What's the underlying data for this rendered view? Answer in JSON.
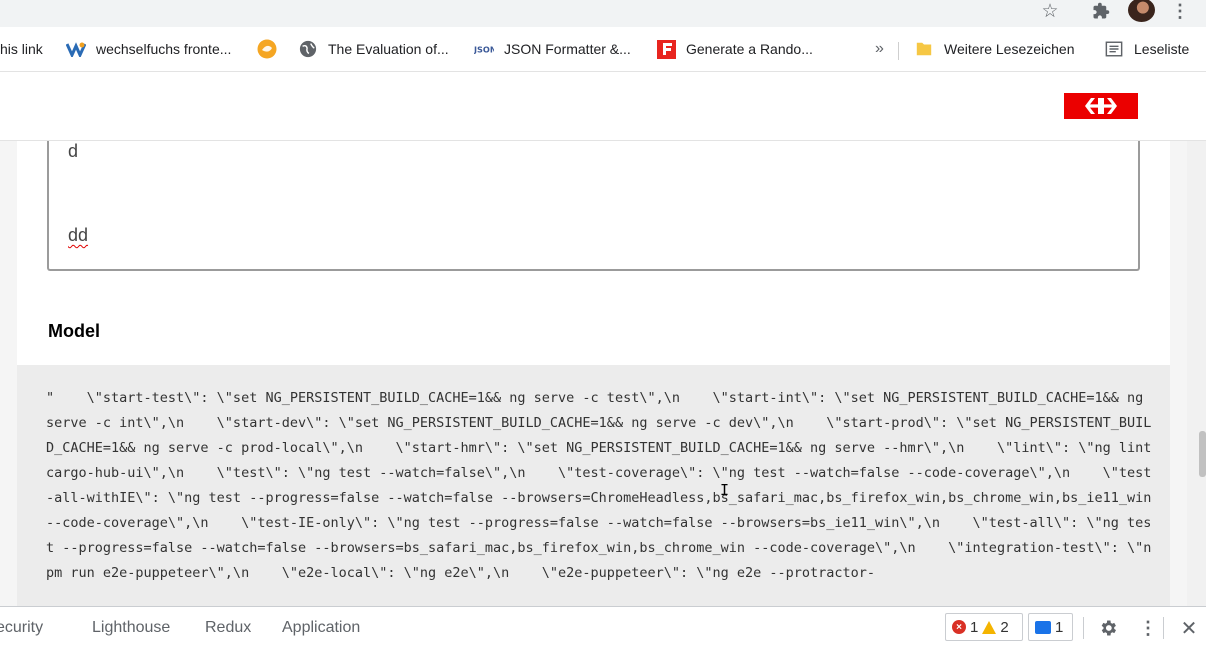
{
  "toolbar": {
    "star_icon": "star-icon",
    "extensions_icon": "puzzle-icon",
    "menu_icon": "kebab-menu-icon"
  },
  "bookmarks": {
    "items": [
      {
        "label": "his link",
        "icon": "none"
      },
      {
        "label": "wechselfuchs fronte...",
        "icon": "wechselfuchs-icon"
      },
      {
        "label": "",
        "icon": "fox-icon"
      },
      {
        "label": "The Evaluation of...",
        "icon": "globe-icon"
      },
      {
        "label": "JSON Formatter &...",
        "icon": "json-icon"
      },
      {
        "label": "Generate a Rando...",
        "icon": "f-icon"
      }
    ],
    "overflow": "»",
    "other_bookmarks": "Weitere Lesezeichen",
    "reading_list": "Leseliste"
  },
  "header": {
    "logo": "sbb-logo"
  },
  "textarea": {
    "line1": "d",
    "line2": "dd"
  },
  "model": {
    "heading": "Model",
    "code": "\"    \\\"start-test\\\": \\\"set NG_PERSISTENT_BUILD_CACHE=1&& ng serve -c test\\\",\\n    \\\"start-int\\\": \\\"set NG_PERSISTENT_BUILD_CACHE=1&& ng serve -c int\\\",\\n    \\\"start-dev\\\": \\\"set NG_PERSISTENT_BUILD_CACHE=1&& ng serve -c dev\\\",\\n    \\\"start-prod\\\": \\\"set NG_PERSISTENT_BUILD_CACHE=1&& ng serve -c prod-local\\\",\\n    \\\"start-hmr\\\": \\\"set NG_PERSISTENT_BUILD_CACHE=1&& ng serve --hmr\\\",\\n    \\\"lint\\\": \\\"ng lint cargo-hub-ui\\\",\\n    \\\"test\\\": \\\"ng test --watch=false\\\",\\n    \\\"test-coverage\\\": \\\"ng test --watch=false --code-coverage\\\",\\n    \\\"test-all-withIE\\\": \\\"ng test --progress=false --watch=false --browsers=ChromeHeadless,bs_safari_mac,bs_firefox_win,bs_chrome_win,bs_ie11_win --code-coverage\\\",\\n    \\\"test-IE-only\\\": \\\"ng test --progress=false --watch=false --browsers=bs_ie11_win\\\",\\n    \\\"test-all\\\": \\\"ng test --progress=false --watch=false --browsers=bs_safari_mac,bs_firefox_win,bs_chrome_win --code-coverage\\\",\\n    \\\"integration-test\\\": \\\"npm run e2e-puppeteer\\\",\\n    \\\"e2e-local\\\": \\\"ng e2e\\\",\\n    \\\"e2e-puppeteer\\\": \\\"ng e2e --protractor-"
  },
  "devtools": {
    "tabs": [
      "ecurity",
      "Lighthouse",
      "Redux",
      "Application"
    ],
    "errors": "1",
    "warnings": "2",
    "messages": "1",
    "settings_icon": "gear-icon",
    "more_icon": "kebab-menu-icon",
    "close_icon": "close-icon"
  }
}
